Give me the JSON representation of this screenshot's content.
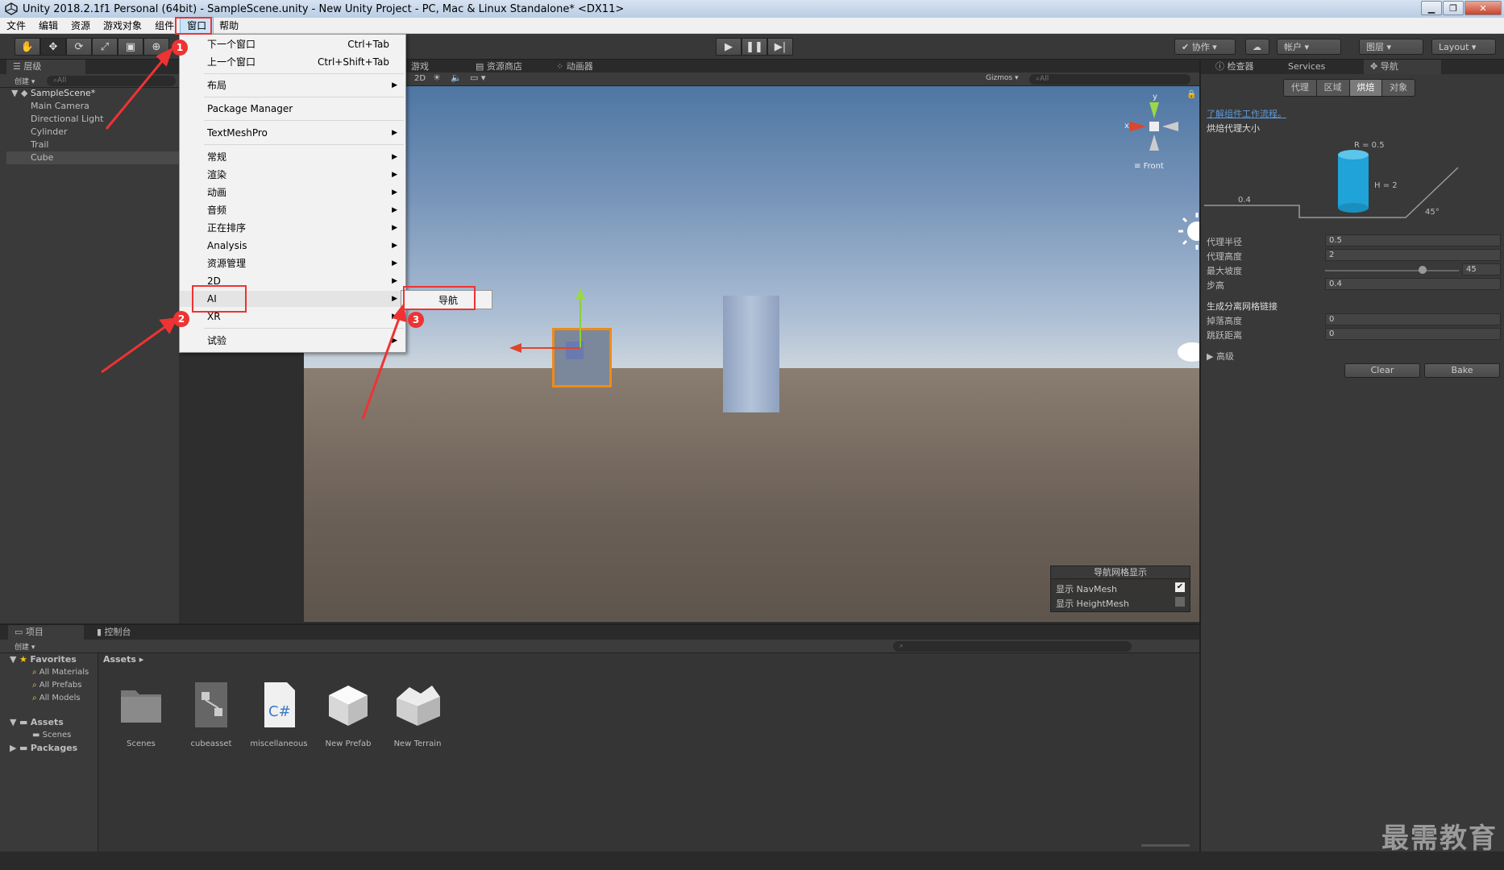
{
  "window": {
    "title": "Unity 2018.2.1f1 Personal (64bit) - SampleScene.unity - New Unity Project - PC, Mac & Linux Standalone* <DX11>"
  },
  "menubar": {
    "items": [
      "文件",
      "编辑",
      "资源",
      "游戏对象",
      "组件",
      "窗口",
      "帮助"
    ]
  },
  "toolbar": {
    "collab": "协作",
    "account": "帐户",
    "layers": "图层",
    "layout": "Layout"
  },
  "window_menu": {
    "items": [
      {
        "label": "下一个窗口",
        "shortcut": "Ctrl+Tab"
      },
      {
        "label": "上一个窗口",
        "shortcut": "Ctrl+Shift+Tab"
      },
      {
        "label": "布局"
      },
      {
        "label": "Package Manager"
      },
      {
        "label": "TextMeshPro"
      },
      {
        "label": "常规"
      },
      {
        "label": "渲染"
      },
      {
        "label": "动画"
      },
      {
        "label": "音频"
      },
      {
        "label": "正在排序"
      },
      {
        "label": "Analysis"
      },
      {
        "label": "资源管理"
      },
      {
        "label": "2D"
      },
      {
        "label": "AI"
      },
      {
        "label": "XR"
      },
      {
        "label": "试验"
      }
    ],
    "submenu_item": "导航"
  },
  "annotations": [
    "1",
    "2",
    "3"
  ],
  "hierarchy": {
    "tab": "层级",
    "create": "创建",
    "search_placeholder": "All",
    "scene": "SampleScene*",
    "items": [
      "Main Camera",
      "Directional Light",
      "Cylinder",
      "Trail",
      "Cube"
    ]
  },
  "scene_view": {
    "tabs": [
      "游戏",
      "资源商店",
      "动画器"
    ],
    "mode_2d": "2D",
    "gizmos": "Gizmos",
    "search_placeholder": "All",
    "view_label": "Front",
    "axis_x": "x",
    "axis_y": "y",
    "overlay": {
      "title": "导航网格显示",
      "show_navmesh": "显示 NavMesh",
      "show_heightmesh": "显示 HeightMesh",
      "navmesh_checked": true,
      "heightmesh_checked": false
    }
  },
  "inspector": {
    "tabs": [
      "检查器",
      "Services",
      "导航"
    ],
    "subtabs": [
      "代理",
      "区域",
      "烘焙",
      "对象"
    ],
    "active_subtab": "烘焙",
    "link": "了解组件工作流程。",
    "section": "烘焙代理大小",
    "diagram": {
      "r": "R = 0.5",
      "h": "H = 2",
      "step": "0.4",
      "angle": "45°"
    },
    "fields": [
      {
        "label": "代理半径",
        "value": "0.5"
      },
      {
        "label": "代理高度",
        "value": "2"
      },
      {
        "label": "最大坡度",
        "value": "45"
      },
      {
        "label": "步高",
        "value": "0.4"
      }
    ],
    "offmesh_section": "生成分离网格链接",
    "offmesh_fields": [
      {
        "label": "掉落高度",
        "value": "0"
      },
      {
        "label": "跳跃距离",
        "value": "0"
      }
    ],
    "advanced": "高级",
    "clear": "Clear",
    "bake": "Bake"
  },
  "project": {
    "tabs": [
      "项目",
      "控制台"
    ],
    "create": "创建",
    "favorites": "Favorites",
    "fav_items": [
      "All Materials",
      "All Prefabs",
      "All Models"
    ],
    "assets_root": "Assets",
    "assets_children": [
      "Scenes"
    ],
    "packages": "Packages",
    "breadcrumb": "Assets",
    "assets": [
      "Scenes",
      "cubeasset",
      "miscellaneous",
      "New Prefab",
      "New Terrain"
    ]
  },
  "watermark": "最需教育"
}
